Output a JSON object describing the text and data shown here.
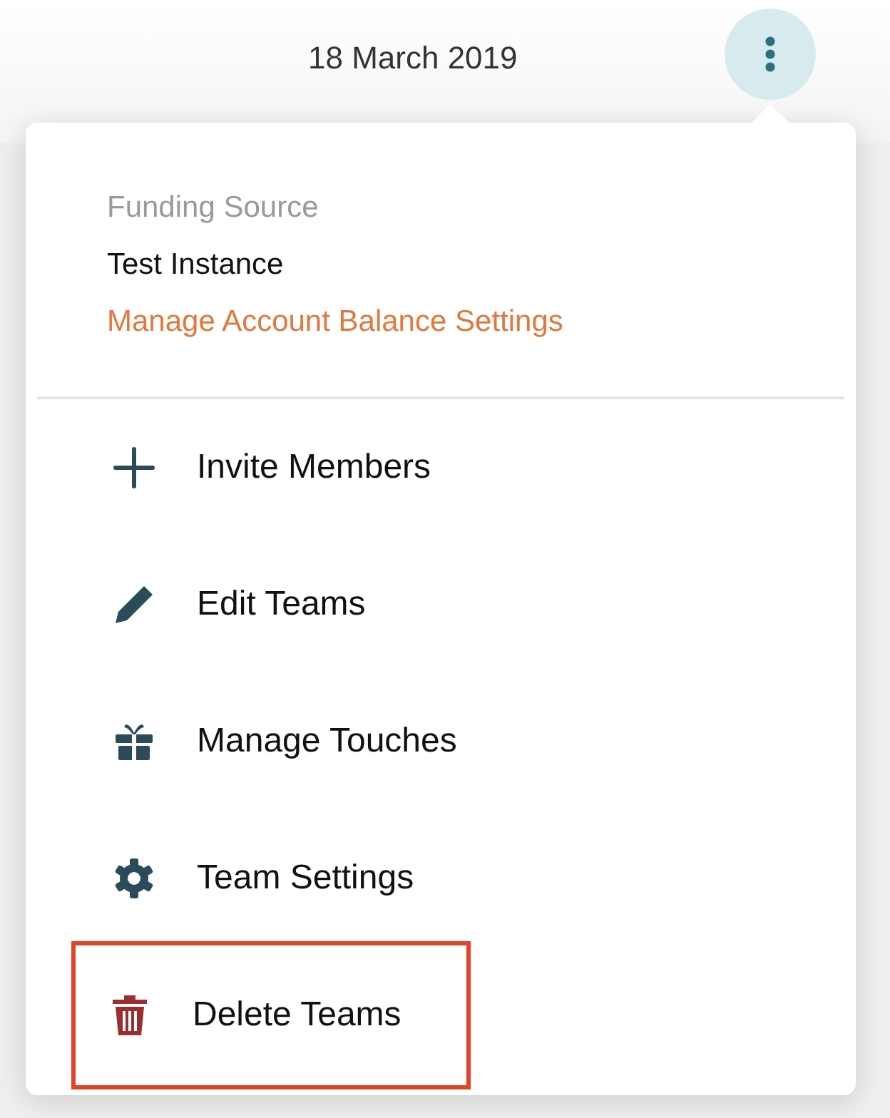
{
  "header": {
    "date": "18 March 2019"
  },
  "menu": {
    "funding_label": "Funding Source",
    "funding_value": "Test Instance",
    "funding_link": "Manage Account Balance Settings",
    "items": [
      {
        "label": "Invite Members",
        "kind": "plus",
        "highlighted": false
      },
      {
        "label": "Edit Teams",
        "kind": "pencil",
        "highlighted": false
      },
      {
        "label": "Manage Touches",
        "kind": "gift",
        "highlighted": false
      },
      {
        "label": "Team Settings",
        "kind": "gear",
        "highlighted": false
      },
      {
        "label": "Delete Teams",
        "kind": "trash",
        "highlighted": true
      }
    ]
  }
}
